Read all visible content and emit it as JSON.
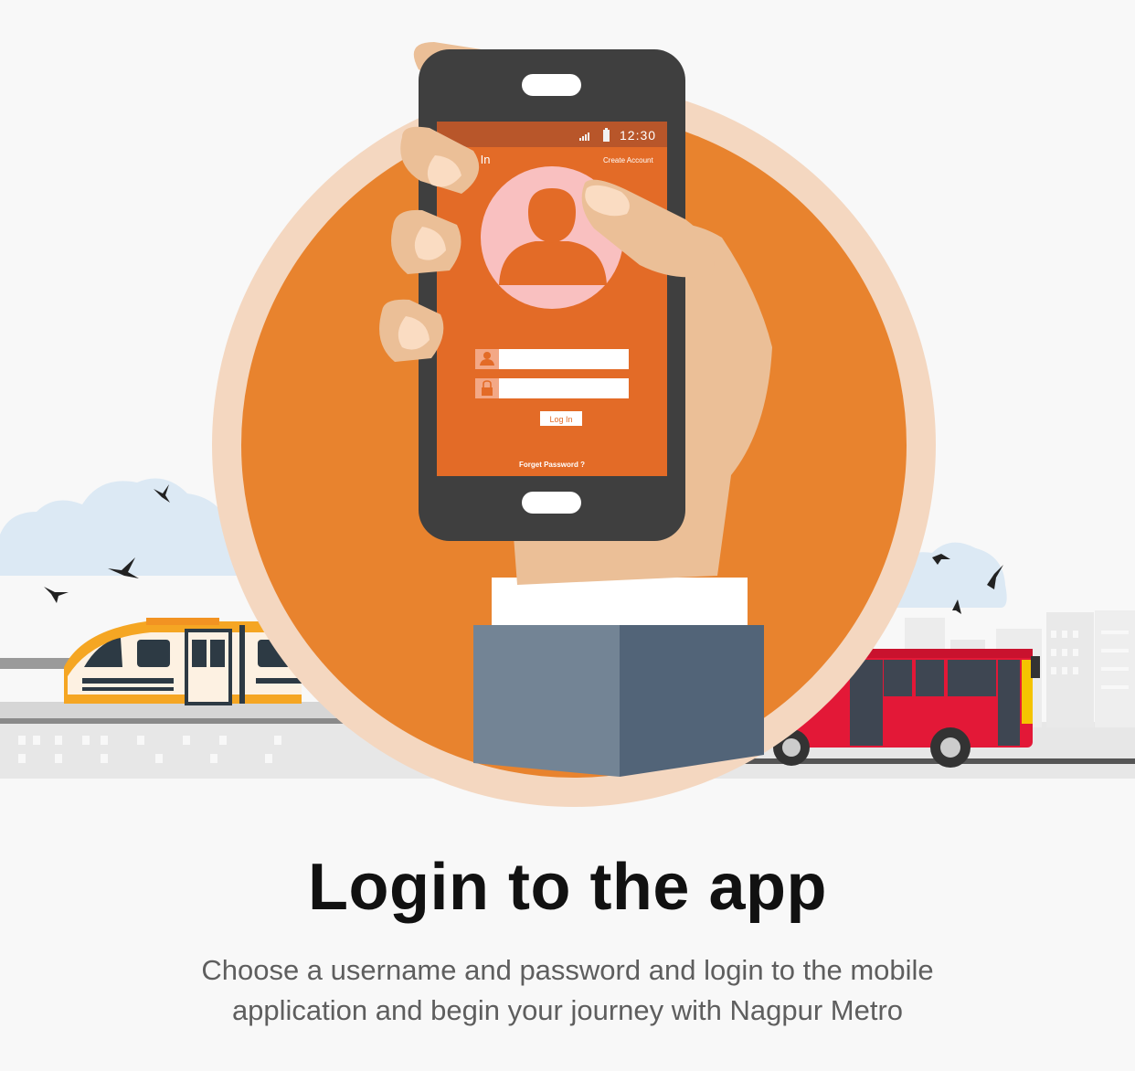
{
  "phone_screen": {
    "time": "12:30",
    "title": "Sign In",
    "create_account_link": "Create Account",
    "login_button": "Log In",
    "forgot_password_link": "Forget Password ?"
  },
  "caption": {
    "headline": "Login to the app",
    "body": "Choose a username and password and login to the mobile application and begin your journey with Nagpur Metro"
  },
  "icons": [
    "signal-icon",
    "battery-icon",
    "user-avatar-icon",
    "user-field-icon",
    "lock-field-icon"
  ],
  "colors": {
    "accent_orange": "#e8832e",
    "screen_orange": "#e36b27",
    "halo": "#f4d7c0",
    "bus_red": "#e31837",
    "metro_yellow": "#f5a623",
    "headline": "#111111",
    "body_text": "#5e5e5e"
  }
}
